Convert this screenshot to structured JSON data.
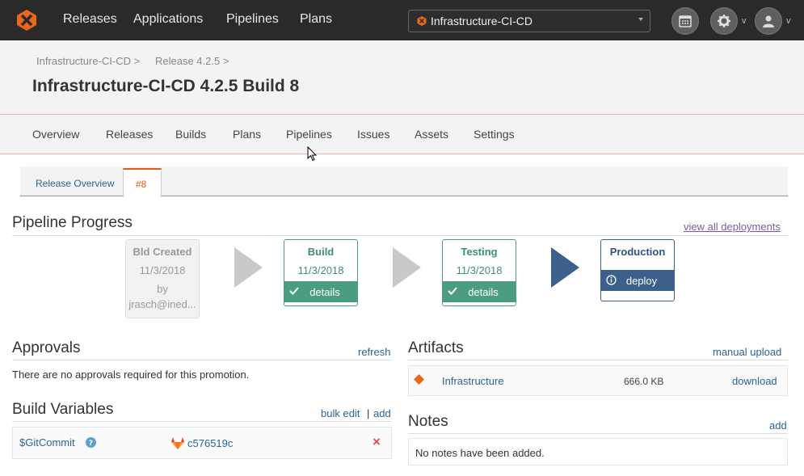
{
  "nav": {
    "links": [
      "Releases",
      "Applications",
      "Pipelines",
      "Plans"
    ],
    "project_selector": "Infrastructure-CI-CD",
    "caret": "v",
    "icons": [
      "octopus-logo-icon",
      "calendar-icon",
      "gear-icon",
      "user-icon"
    ]
  },
  "header": {
    "breadcrumb": [
      "Infrastructure-CI-CD >",
      "Release 4.2.5 >"
    ],
    "title": "Infrastructure-CI-CD 4.2.5 Build 8"
  },
  "tabs": [
    "Overview",
    "Releases",
    "Builds",
    "Plans",
    "Pipelines",
    "Issues",
    "Assets",
    "Settings"
  ],
  "subtabs": [
    "Release Overview",
    "#8"
  ],
  "pipeline": {
    "title": "Pipeline Progress",
    "link": "view all deployments",
    "stages": [
      {
        "title": "Bld Created",
        "date": "11/3/2018",
        "by": "by",
        "user": "jrasch@ined..."
      },
      {
        "title": "Build",
        "date": "11/3/2018",
        "button": "details"
      },
      {
        "title": "Testing",
        "date": "11/3/2018",
        "button": "details"
      },
      {
        "title": "Production",
        "button": "deploy"
      }
    ]
  },
  "approvals": {
    "title": "Approvals",
    "link": "refresh",
    "empty": "There are no approvals required for this promotion."
  },
  "variables": {
    "title": "Build Variables",
    "bulk_edit": "bulk edit",
    "separator": "|",
    "add": "add",
    "rows": [
      {
        "name": "$GitCommit",
        "value": "c576519c",
        "remove": "×"
      }
    ]
  },
  "artifacts": {
    "title": "Artifacts",
    "link": "manual upload",
    "rows": [
      {
        "name": "Infrastructure",
        "size": "666.0 KB",
        "action": "download"
      }
    ]
  },
  "notes": {
    "title": "Notes",
    "add": "add",
    "empty": "No notes have been added."
  },
  "colors": {
    "accent": "#e05a1b",
    "success": "#4a9d80",
    "primary": "#3c5f8c"
  }
}
